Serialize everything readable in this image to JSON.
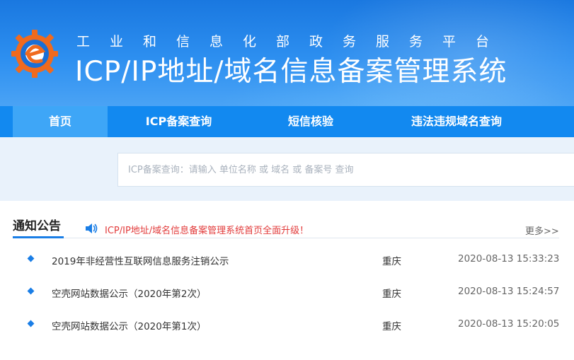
{
  "header": {
    "subtitle": "工业和信息化部政务服务平台",
    "title": "ICP/IP地址/域名信息备案管理系统",
    "brand_colors": {
      "banner": "#1a78e0",
      "logo_orange": "#f06a1e",
      "logo_blue": "#1a6fd6"
    }
  },
  "nav": {
    "items": [
      {
        "label": "首页",
        "active": true
      },
      {
        "label": "ICP备案查询",
        "active": false
      },
      {
        "label": "短信核验",
        "active": false
      },
      {
        "label": "违法违规域名查询",
        "active": false
      }
    ]
  },
  "search": {
    "placeholder": "ICP备案查询：请输入 单位名称 或 域名 或 备案号 查询",
    "value": ""
  },
  "notice": {
    "heading": "通知公告",
    "marquee": "ICP/IP地址/域名信息备案管理系统首页全面升级！",
    "more": "更多>>",
    "icon": "speaker-icon",
    "items": [
      {
        "title": "2019年非经营性互联网信息服务注销公示",
        "region": "重庆",
        "date": "2020-08-13 15:33:23"
      },
      {
        "title": "空壳网站数据公示（2020年第2次）",
        "region": "重庆",
        "date": "2020-08-13 15:24:57"
      },
      {
        "title": "空壳网站数据公示（2020年第1次）",
        "region": "重庆",
        "date": "2020-08-13 15:20:05"
      }
    ]
  }
}
